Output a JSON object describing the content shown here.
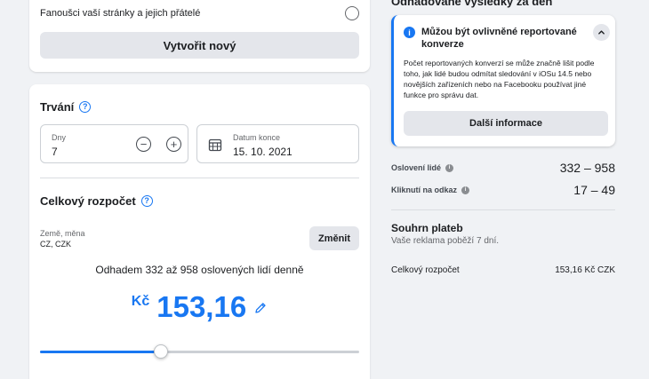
{
  "audience": {
    "label": "Fanoušci vaší stránky a jejich přátelé"
  },
  "create_button": "Vytvořit nový",
  "duration": {
    "title": "Trvání",
    "days_label": "Dny",
    "days_value": "7",
    "end_label": "Datum konce",
    "end_value": "15. 10. 2021"
  },
  "budget": {
    "title": "Celkový rozpočet",
    "country_label": "Země, měna",
    "country_value": "CZ, CZK",
    "change_button": "Změnit",
    "estimate": "Odhadem 332 až 958 oslovených lidí denně",
    "currency": "Kč",
    "amount": "153,16",
    "slider_fraction": 0.38
  },
  "results": {
    "heading": "Odhadované výsledky za den",
    "notice": {
      "title": "Můžou být ovlivněné reportované konverze",
      "body": "Počet reportovaných konverzí se může značně lišit podle toho, jak lidé budou odmítat sledování v iOSu 14.5 nebo novějších zařízeních nebo na Facebooku používat jiné funkce pro správu dat.",
      "button": "Další informace"
    },
    "reach_label": "Oslovení lidé",
    "reach_value": "332 – 958",
    "clicks_label": "Kliknutí na odkaz",
    "clicks_value": "17 – 49"
  },
  "payment": {
    "title": "Souhrn plateb",
    "subtitle": "Vaše reklama poběží 7 dní.",
    "total_label": "Celkový rozpočet",
    "total_value": "153,16 Kč CZK"
  },
  "colors": {
    "accent": "#1877f2",
    "background": "#f0f2f5"
  }
}
